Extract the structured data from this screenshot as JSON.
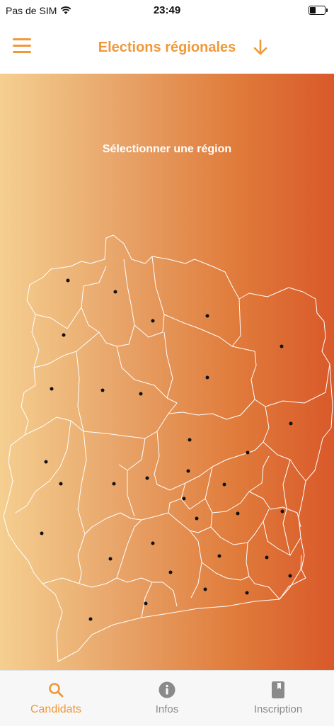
{
  "status_bar": {
    "carrier": "Pas de SIM",
    "time": "23:49"
  },
  "nav": {
    "title": "Elections régionales",
    "menu_icon": "hamburger-icon",
    "download_icon": "arrow-down-icon",
    "accent_color": "#f0993a"
  },
  "map": {
    "prompt": "Sélectionner une région",
    "gradient": [
      "#f5cf90",
      "#d9592a"
    ]
  },
  "tabs": [
    {
      "label": "Candidats",
      "icon": "search-icon",
      "active": true
    },
    {
      "label": "Infos",
      "icon": "info-icon",
      "active": false
    },
    {
      "label": "Inscription",
      "icon": "bookmark-icon",
      "active": false
    }
  ]
}
